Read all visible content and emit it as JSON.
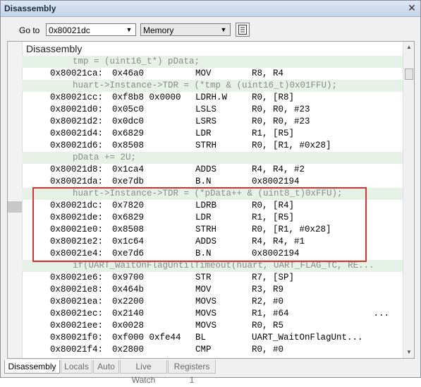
{
  "window": {
    "title": "Disassembly"
  },
  "toolbar": {
    "goto_label": "Go to",
    "goto_value": "0x80021dc",
    "view_select": "Memory"
  },
  "panel": {
    "header": "Disassembly"
  },
  "lines": [
    {
      "type": "src",
      "text": "tmp = (uint16_t*) pData;"
    },
    {
      "type": "asm",
      "addr": "0x80021ca:",
      "op": "0x46a0",
      "mn": "MOV",
      "args": "R8, R4"
    },
    {
      "type": "src",
      "text": "huart->Instance->TDR = (*tmp & (uint16_t)0x01FFU);"
    },
    {
      "type": "asm",
      "addr": "0x80021cc:",
      "op": "0xf8b8 0x0000",
      "mn": "LDRH.W",
      "args": "R0, [R8]"
    },
    {
      "type": "asm",
      "addr": "0x80021d0:",
      "op": "0x05c0",
      "mn": "LSLS",
      "args": "R0, R0, #23"
    },
    {
      "type": "asm",
      "addr": "0x80021d2:",
      "op": "0x0dc0",
      "mn": "LSRS",
      "args": "R0, R0, #23"
    },
    {
      "type": "asm",
      "addr": "0x80021d4:",
      "op": "0x6829",
      "mn": "LDR",
      "args": "R1, [R5]"
    },
    {
      "type": "asm",
      "addr": "0x80021d6:",
      "op": "0x8508",
      "mn": "STRH",
      "args": "R0, [R1, #0x28]"
    },
    {
      "type": "src",
      "text": "pData += 2U;"
    },
    {
      "type": "asm",
      "addr": "0x80021d8:",
      "op": "0x1ca4",
      "mn": "ADDS",
      "args": "R4, R4, #2"
    },
    {
      "type": "asm",
      "addr": "0x80021da:",
      "op": "0xe7db",
      "mn": "B.N",
      "args": "0x8002194"
    },
    {
      "type": "src",
      "text": "huart->Instance->TDR = (*pData++ & (uint8_t)0xFFU);"
    },
    {
      "type": "asm",
      "addr": "0x80021dc:",
      "op": "0x7820",
      "mn": "LDRB",
      "args": "R0, [R4]"
    },
    {
      "type": "asm",
      "addr": "0x80021de:",
      "op": "0x6829",
      "mn": "LDR",
      "args": "R1, [R5]"
    },
    {
      "type": "asm",
      "addr": "0x80021e0:",
      "op": "0x8508",
      "mn": "STRH",
      "args": "R0, [R1, #0x28]"
    },
    {
      "type": "asm",
      "addr": "0x80021e2:",
      "op": "0x1c64",
      "mn": "ADDS",
      "args": "R4, R4, #1"
    },
    {
      "type": "asm",
      "addr": "0x80021e4:",
      "op": "0xe7d6",
      "mn": "B.N",
      "args": "0x8002194"
    },
    {
      "type": "src",
      "text": "if(UART_WaitOnFlagUntilTimeout(huart, UART_FLAG_TC, RE..."
    },
    {
      "type": "asm",
      "addr": "0x80021e6:",
      "op": "0x9700",
      "mn": "STR",
      "args": "R7, [SP]"
    },
    {
      "type": "asm",
      "addr": "0x80021e8:",
      "op": "0x464b",
      "mn": "MOV",
      "args": "R3, R9"
    },
    {
      "type": "asm",
      "addr": "0x80021ea:",
      "op": "0x2200",
      "mn": "MOVS",
      "args": "R2, #0"
    },
    {
      "type": "asm",
      "addr": "0x80021ec:",
      "op": "0x2140",
      "mn": "MOVS",
      "args": "R1, #64                ..."
    },
    {
      "type": "asm",
      "addr": "0x80021ee:",
      "op": "0x0028",
      "mn": "MOVS",
      "args": "R0, R5"
    },
    {
      "type": "asm",
      "addr": "0x80021f0:",
      "op": "0xf000 0xfe44",
      "mn": "BL",
      "args": "UART_WaitOnFlagUnt..."
    },
    {
      "type": "asm",
      "addr": "0x80021f4:",
      "op": "0x2800",
      "mn": "CMP",
      "args": "R0, #0"
    }
  ],
  "tabs": [
    {
      "label": "Disassembly",
      "active": true
    },
    {
      "label": "Locals",
      "active": false
    },
    {
      "label": "Auto",
      "active": false
    },
    {
      "label": "Live Watch",
      "active": false
    },
    {
      "label": "Registers 1",
      "active": false
    }
  ],
  "colors": {
    "source_line_bg": "#e6f2e6",
    "highlight_border": "#e0302e",
    "current_line_marker": "#c8c8c8"
  }
}
